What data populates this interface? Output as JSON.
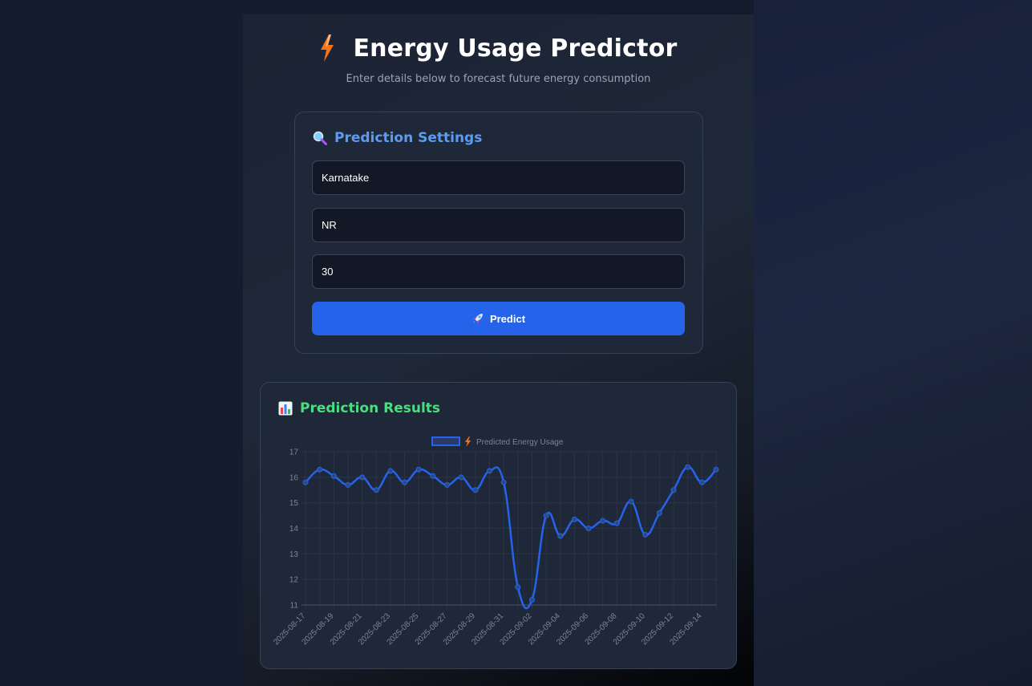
{
  "header": {
    "title": "Energy Usage Predictor",
    "subtitle": "Enter details below to forecast future energy consumption"
  },
  "settings": {
    "title": "Prediction Settings",
    "icon": "magnifier-icon",
    "state_value": "Karnatake",
    "region_value": "NR",
    "days_value": "30",
    "predict_label": "Predict",
    "predict_icon": "rocket-icon"
  },
  "results": {
    "title": "Prediction Results",
    "icon": "bar-chart-icon"
  },
  "colors": {
    "accent_blue": "#2563eb",
    "settings_title": "#5b9cf2",
    "results_title": "#4ade80",
    "bolt": "#f97316"
  },
  "chart_data": {
    "type": "line",
    "legend": "Predicted Energy Usage",
    "legend_icon": "bolt-icon",
    "legend_position": "top",
    "ylim": [
      11,
      17
    ],
    "yticks": [
      11,
      12,
      13,
      14,
      15,
      16,
      17
    ],
    "grid": true,
    "x": [
      "2025-08-17",
      "2025-08-18",
      "2025-08-19",
      "2025-08-20",
      "2025-08-21",
      "2025-08-22",
      "2025-08-23",
      "2025-08-24",
      "2025-08-25",
      "2025-08-26",
      "2025-08-27",
      "2025-08-28",
      "2025-08-29",
      "2025-08-30",
      "2025-08-31",
      "2025-09-01",
      "2025-09-02",
      "2025-09-03",
      "2025-09-04",
      "2025-09-05",
      "2025-09-06",
      "2025-09-07",
      "2025-09-08",
      "2025-09-09",
      "2025-09-10",
      "2025-09-11",
      "2025-09-12",
      "2025-09-13",
      "2025-09-14",
      "2025-09-15"
    ],
    "xtick_labels": [
      "2025-08-17",
      "2025-08-19",
      "2025-08-21",
      "2025-08-23",
      "2025-08-25",
      "2025-08-27",
      "2025-08-29",
      "2025-08-31",
      "2025-09-02",
      "2025-09-04",
      "2025-09-06",
      "2025-09-08",
      "2025-09-10",
      "2025-09-12",
      "2025-09-14"
    ],
    "series": [
      {
        "name": "Predicted Energy Usage",
        "color": "#2563eb",
        "values": [
          15.8,
          16.3,
          16.05,
          15.7,
          16.0,
          15.5,
          16.25,
          15.8,
          16.3,
          16.05,
          15.7,
          16.0,
          15.5,
          16.25,
          15.8,
          11.7,
          11.2,
          14.5,
          13.7,
          14.35,
          14.0,
          14.3,
          14.2,
          15.05,
          13.75,
          14.6,
          15.5,
          16.4,
          15.8,
          16.3
        ]
      }
    ]
  }
}
